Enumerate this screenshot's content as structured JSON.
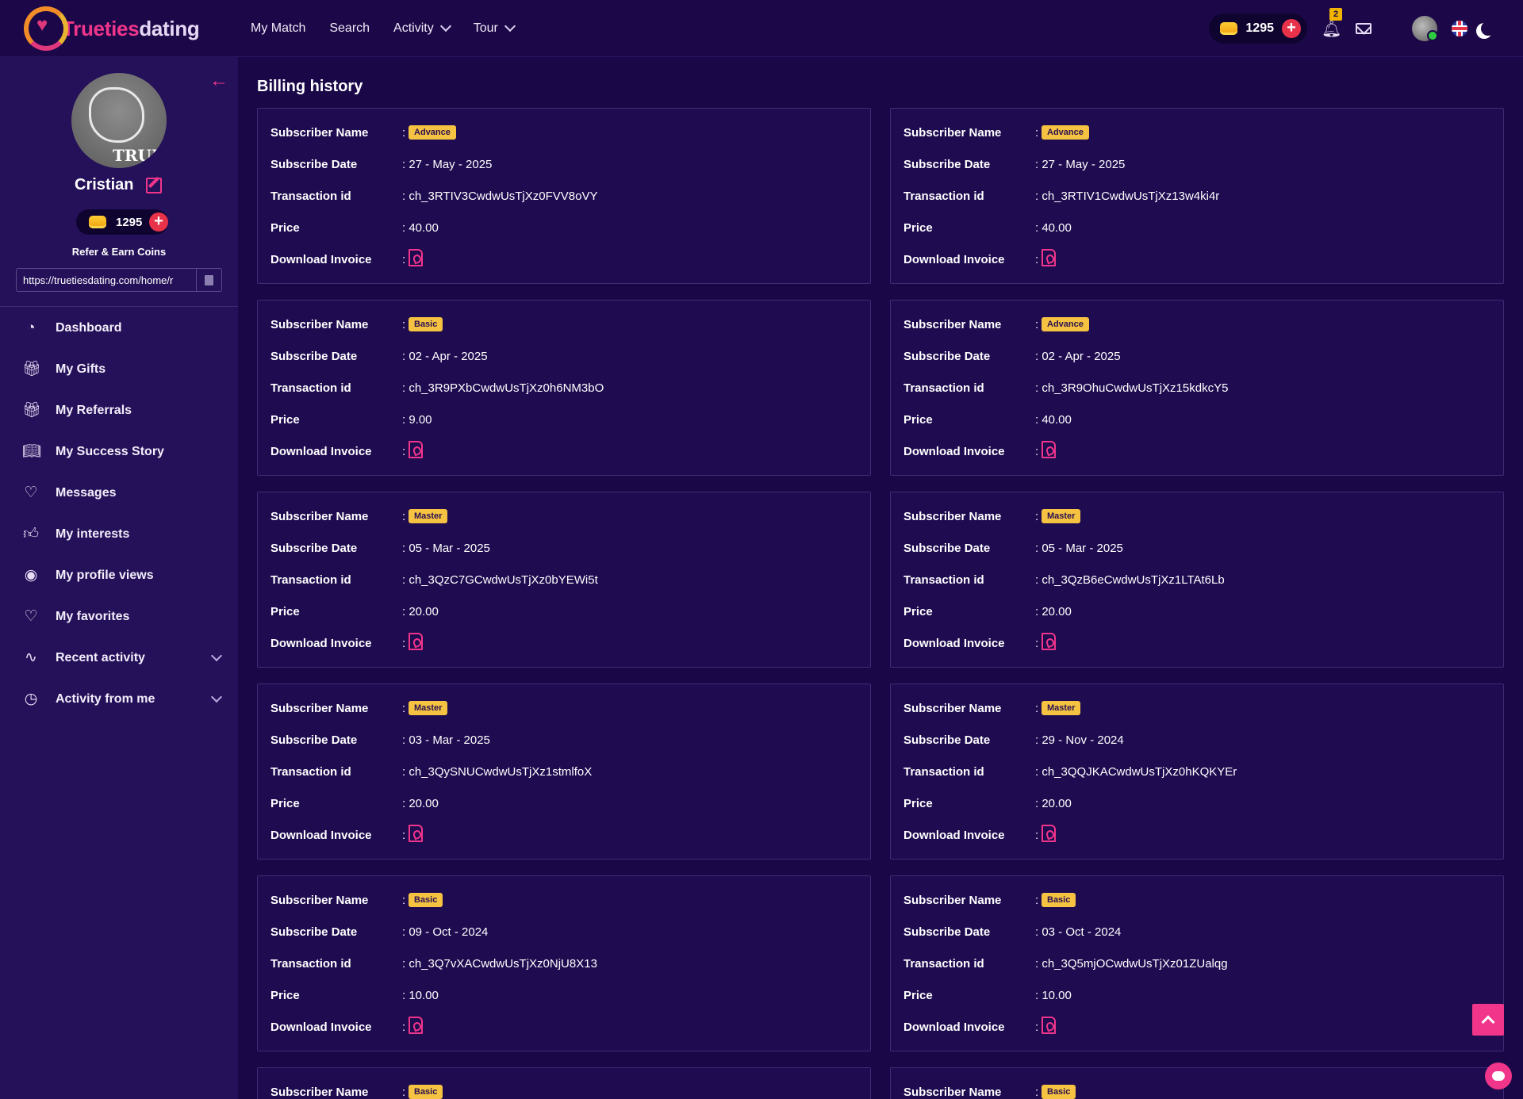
{
  "brand": {
    "name_part1": "Trueties",
    "name_part2": "dating"
  },
  "nav": [
    {
      "label": "My Match",
      "has_dropdown": false
    },
    {
      "label": "Search",
      "has_dropdown": false
    },
    {
      "label": "Activity",
      "has_dropdown": true
    },
    {
      "label": "Tour",
      "has_dropdown": true
    }
  ],
  "topbar": {
    "coins": "1295",
    "notification_count": "2",
    "icons": [
      "coin-icon",
      "add-coins-icon",
      "bell-icon",
      "mail-icon",
      "avatar",
      "uk-flag-icon",
      "moon-icon"
    ]
  },
  "profile": {
    "avatar_text": "TRUM",
    "name": "Cristian",
    "coins": "1295",
    "refer_label": "Refer & Earn Coins",
    "refer_link": "https://truetiesdating.com/home/r"
  },
  "sidebar": {
    "items": [
      {
        "label": "Dashboard",
        "icon": "dashboard-icon",
        "glyph": "◔",
        "expandable": false
      },
      {
        "label": "My Gifts",
        "icon": "gift-icon",
        "glyph": "🎁︎",
        "expandable": false
      },
      {
        "label": "My Referrals",
        "icon": "referrals-icon",
        "glyph": "🎁︎",
        "expandable": false
      },
      {
        "label": "My Success Story",
        "icon": "book-icon",
        "glyph": "📖︎",
        "expandable": false
      },
      {
        "label": "Messages",
        "icon": "message-heart-icon",
        "glyph": "♡",
        "expandable": false
      },
      {
        "label": "My interests",
        "icon": "thumbs-up-icon",
        "glyph": "👍︎",
        "expandable": false
      },
      {
        "label": "My profile views",
        "icon": "eye-icon",
        "glyph": "◉",
        "expandable": false
      },
      {
        "label": "My favorites",
        "icon": "heart-icon",
        "glyph": "♡",
        "expandable": false
      },
      {
        "label": "Recent activity",
        "icon": "activity-icon",
        "glyph": "∿",
        "expandable": true
      },
      {
        "label": "Activity from me",
        "icon": "clock-icon",
        "glyph": "◷",
        "expandable": true
      }
    ]
  },
  "billing": {
    "title": "Billing history",
    "labels": {
      "subscriber_name": "Subscriber Name",
      "subscribe_date": "Subscribe Date",
      "transaction_id": "Transaction id",
      "price": "Price",
      "download_invoice": "Download Invoice"
    },
    "colon": ":",
    "records": [
      {
        "plan": "Advance",
        "date": ": 27 - May - 2025",
        "txn": ": ch_3RTIV3CwdwUsTjXz0FVV8oVY",
        "price": ": 40.00"
      },
      {
        "plan": "Advance",
        "date": ": 27 - May - 2025",
        "txn": ": ch_3RTIV1CwdwUsTjXz13w4ki4r",
        "price": ": 40.00"
      },
      {
        "plan": "Basic",
        "date": ": 02 - Apr - 2025",
        "txn": ": ch_3R9PXbCwdwUsTjXz0h6NM3bO",
        "price": ": 9.00"
      },
      {
        "plan": "Advance",
        "date": ": 02 - Apr - 2025",
        "txn": ": ch_3R9OhuCwdwUsTjXz15kdkcY5",
        "price": ": 40.00"
      },
      {
        "plan": "Master",
        "date": ": 05 - Mar - 2025",
        "txn": ": ch_3QzC7GCwdwUsTjXz0bYEWi5t",
        "price": ": 20.00"
      },
      {
        "plan": "Master",
        "date": ": 05 - Mar - 2025",
        "txn": ": ch_3QzB6eCwdwUsTjXz1LTAt6Lb",
        "price": ": 20.00"
      },
      {
        "plan": "Master",
        "date": ": 03 - Mar - 2025",
        "txn": ": ch_3QySNUCwdwUsTjXz1stmlfoX",
        "price": ": 20.00"
      },
      {
        "plan": "Master",
        "date": ": 29 - Nov - 2024",
        "txn": ": ch_3QQJKACwdwUsTjXz0hKQKYEr",
        "price": ": 20.00"
      },
      {
        "plan": "Basic",
        "date": ": 09 - Oct - 2024",
        "txn": ": ch_3Q7vXACwdwUsTjXz0NjU8X13",
        "price": ": 10.00"
      },
      {
        "plan": "Basic",
        "date": ": 03 - Oct - 2024",
        "txn": ": ch_3Q5mjOCwdwUsTjXz01ZUalqg",
        "price": ": 10.00"
      },
      {
        "plan": "Basic",
        "partial": true
      },
      {
        "plan": "Basic",
        "partial": true
      }
    ]
  },
  "colors": {
    "accent": "#f0358a",
    "badge": "#f5c242",
    "background": "#1a0747",
    "sidebar": "#251159"
  }
}
